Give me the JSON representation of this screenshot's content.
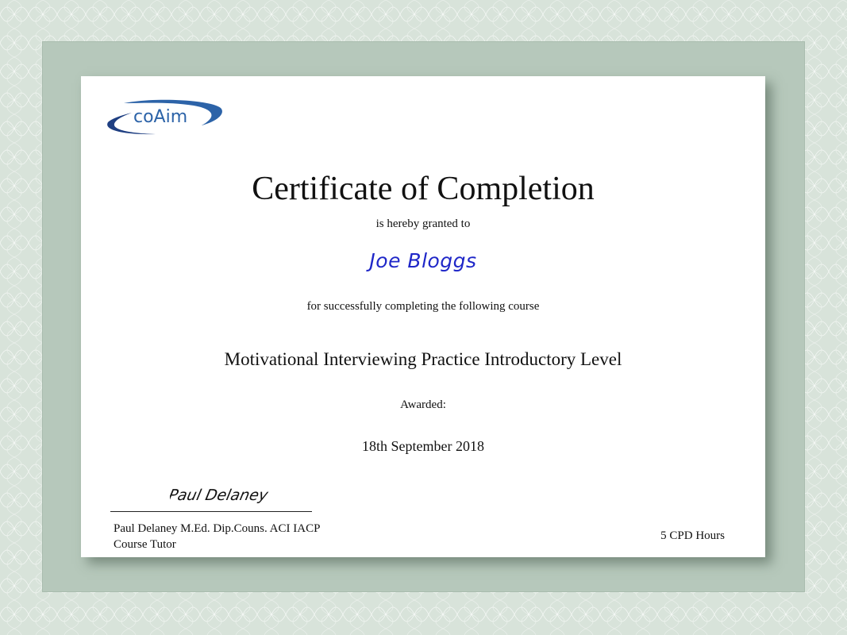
{
  "certificate": {
    "logo_text": "coAim",
    "title": "Certificate of Completion",
    "granted_text": "is hereby granted to",
    "recipient_name": "Joe Bloggs",
    "completion_text": "for successfully completing the following course",
    "course_name": "Motivational Interviewing Practice Introductory Level",
    "awarded_label": "Awarded:",
    "awarded_date": "18th September 2018",
    "signature_text": "Paul Delaney",
    "tutor_name": "Paul Delaney M.Ed. Dip.Couns. ACI IACP",
    "tutor_role": "Course Tutor",
    "cpd_hours": "5 CPD Hours"
  },
  "colors": {
    "background": "#d8e3da",
    "frame": "#b6c8bb",
    "recipient": "#1f27c8",
    "logo_blue": "#2c63a8"
  }
}
